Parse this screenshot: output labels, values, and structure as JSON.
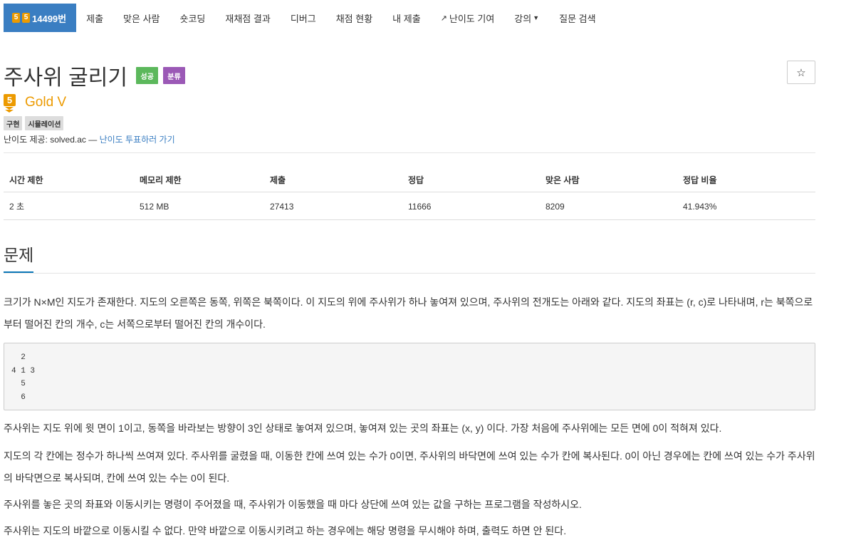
{
  "nav": {
    "problem_badge": "5",
    "problem_id": "14499번",
    "items": [
      "제출",
      "맞은 사람",
      "숏코딩",
      "재채점 결과",
      "디버그",
      "채점 현황",
      "내 제출",
      "난이도 기여",
      "강의",
      "질문 검색"
    ]
  },
  "problem": {
    "title": "주사위 굴리기",
    "labels": {
      "success": "성공",
      "category": "분류"
    },
    "star": "☆",
    "tier_num": "5",
    "tier_name": "Gold V",
    "tags": [
      "구현",
      "시뮬레이션"
    ],
    "provider_text": "난이도 제공: solved.ac — ",
    "provider_link": "난이도 투표하러 가기"
  },
  "stats": {
    "headers": [
      "시간 제한",
      "메모리 제한",
      "제출",
      "정답",
      "맞은 사람",
      "정답 비율"
    ],
    "values": [
      "2 초",
      "512 MB",
      "27413",
      "11666",
      "8209",
      "41.943%"
    ]
  },
  "section": {
    "title": "문제",
    "p1": "크기가 N×M인 지도가 존재한다. 지도의 오른쪽은 동쪽, 위쪽은 북쪽이다. 이 지도의 위에 주사위가 하나 놓여져 있으며, 주사위의 전개도는 아래와 같다. 지도의 좌표는 (r, c)로 나타내며, r는 북쪽으로부터 떨어진 칸의 개수, c는 서쪽으로부터 떨어진 칸의 개수이다.",
    "dice_net": "  2\n4 1 3\n  5\n  6",
    "p2": "주사위는 지도 위에 윗 면이 1이고, 동쪽을 바라보는 방향이 3인 상태로 놓여져 있으며, 놓여져 있는 곳의 좌표는 (x, y) 이다. 가장 처음에 주사위에는 모든 면에 0이 적혀져 있다.",
    "p3": "지도의 각 칸에는 정수가 하나씩 쓰여져 있다. 주사위를 굴렸을 때, 이동한 칸에 쓰여 있는 수가 0이면, 주사위의 바닥면에 쓰여 있는 수가 칸에 복사된다. 0이 아닌 경우에는 칸에 쓰여 있는 수가 주사위의 바닥면으로 복사되며, 칸에 쓰여 있는 수는 0이 된다.",
    "p4": "주사위를 놓은 곳의 좌표와 이동시키는 명령이 주어졌을 때, 주사위가 이동했을 때 마다 상단에 쓰여 있는 값을 구하는 프로그램을 작성하시오.",
    "p5": "주사위는 지도의 바깥으로 이동시킬 수 없다. 만약 바깥으로 이동시키려고 하는 경우에는 해당 명령을 무시해야 하며, 출력도 하면 안 된다."
  },
  "colors": {
    "accent": "#3a7ec2",
    "gold": "#ec9a00",
    "success": "#5cb85c",
    "category": "#9b59b6"
  }
}
